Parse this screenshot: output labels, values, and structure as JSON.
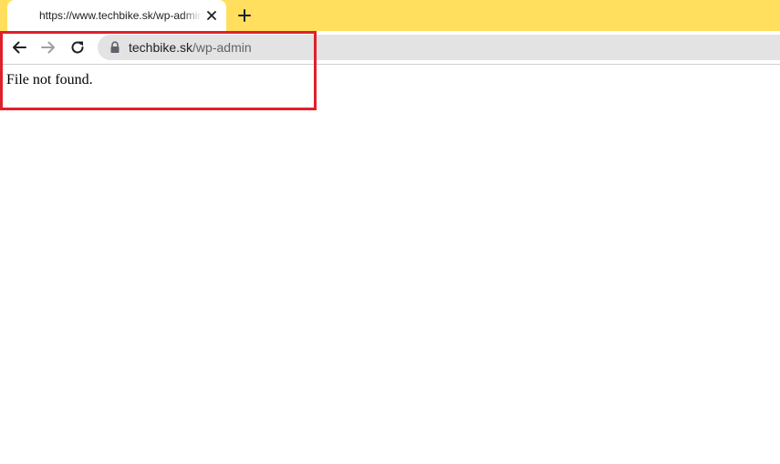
{
  "browser": {
    "tab": {
      "title": "https://www.techbike.sk/wp-admin",
      "close_icon": "close-icon"
    },
    "new_tab_icon": "plus-icon",
    "toolbar": {
      "back_icon": "back-arrow-icon",
      "forward_icon": "forward-arrow-icon",
      "reload_icon": "reload-icon"
    },
    "address_bar": {
      "lock_icon": "lock-icon",
      "host": "techbike.sk",
      "path": "/wp-admin"
    },
    "colors": {
      "tabstrip": "#ffdf5d",
      "highlight": "#e0202a"
    }
  },
  "page": {
    "message": "File not found."
  }
}
